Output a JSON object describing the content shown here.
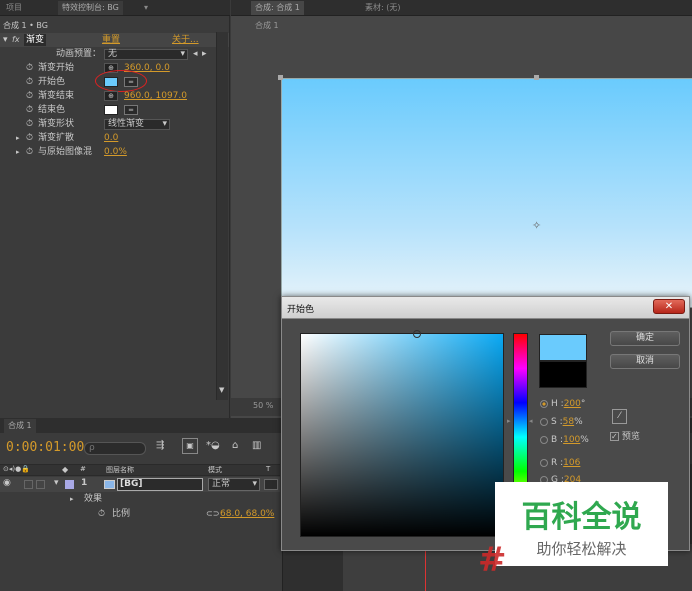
{
  "top_tabs": {
    "project": "项目",
    "effect_controls": "特效控制台: BG",
    "comp_tab": "合成: 合成 1",
    "footage_tab": "素材: (无)"
  },
  "effect_panel": {
    "breadcrumb": "合成 1 • BG",
    "effect_name": "渐变",
    "reset": "重置",
    "about": "关于...",
    "preset_label": "动画预置：",
    "preset_value": "无",
    "props": [
      {
        "label": "渐变开始",
        "value": "360.0, 0.0"
      },
      {
        "label": "开始色",
        "value": ""
      },
      {
        "label": "渐变结束",
        "value": "960.0, 1097.0"
      },
      {
        "label": "结束色",
        "value": ""
      },
      {
        "label": "渐变形状",
        "value": "线性渐变"
      },
      {
        "label": "渐变扩散",
        "value": "0.0"
      },
      {
        "label": "与原始图像混",
        "value": "0.0%"
      }
    ]
  },
  "comp_viewer": {
    "breadcrumb": "合成 1",
    "zoom": "50 %"
  },
  "timeline": {
    "tab": "合成 1",
    "timecode": "0:00:01:00",
    "search_placeholder": "ρ",
    "col_source": "图层名称",
    "col_mode": "模式",
    "col_t": "T",
    "layer_num": "1",
    "layer_name": "[BG]",
    "layer_mode": "正常",
    "effects_label": "效果",
    "scale_label": "比例",
    "scale_value": "68.0, 68.0%"
  },
  "color_dialog": {
    "title": "开始色",
    "ok": "确定",
    "cancel": "取消",
    "preview": "预览",
    "fields": [
      {
        "label": "H",
        "value": "200",
        "unit": "°"
      },
      {
        "label": "S",
        "value": "58",
        "unit": "%"
      },
      {
        "label": "B",
        "value": "100",
        "unit": "%"
      },
      {
        "label": "R",
        "value": "106",
        "unit": ""
      },
      {
        "label": "G",
        "value": "204",
        "unit": ""
      }
    ]
  },
  "watermark": {
    "title": "百科全说",
    "subtitle": "助你轻松解决"
  },
  "colors": {
    "start_color": "#6acbfd",
    "end_color": "#ffffff",
    "accent": "#d49a2a",
    "watermark_green": "#2fa84f"
  }
}
